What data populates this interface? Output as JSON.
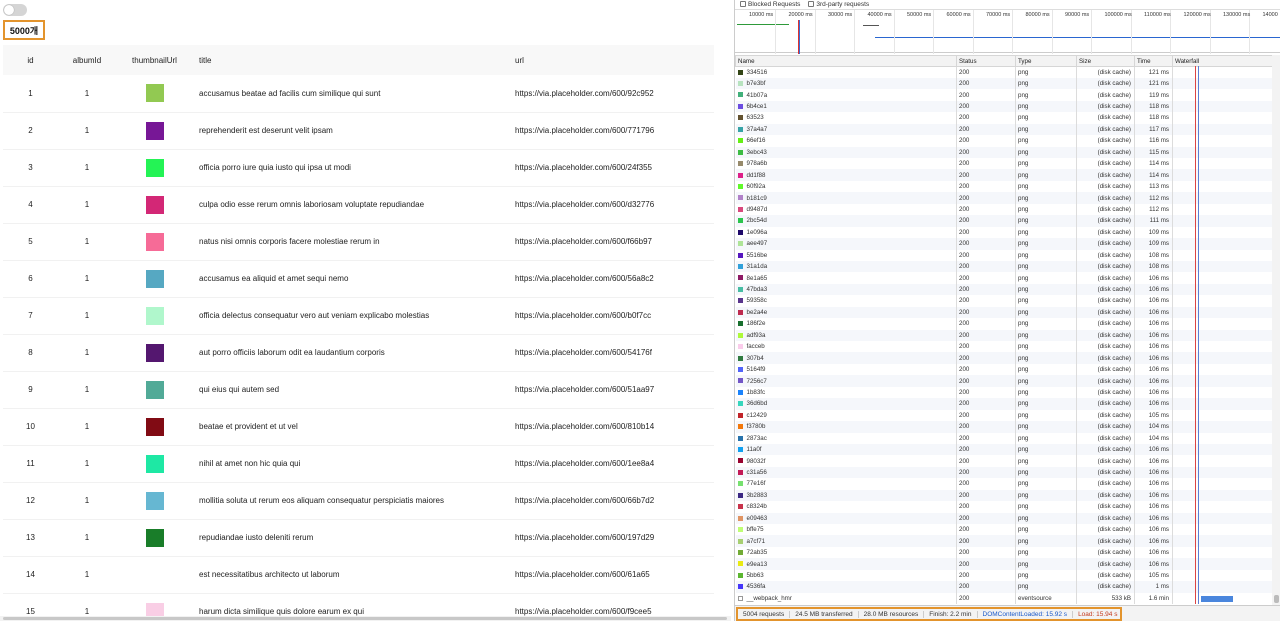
{
  "app": {
    "count_label": "5000개",
    "columns": [
      "id",
      "albumId",
      "thumbnailUrl",
      "title",
      "url"
    ],
    "rows": [
      {
        "id": "1",
        "albumId": "1",
        "color": "#92c952",
        "title": "accusamus beatae ad facilis cum similique qui sunt",
        "url": "https://via.placeholder.com/600/92c952"
      },
      {
        "id": "2",
        "albumId": "1",
        "color": "#771796",
        "title": "reprehenderit est deserunt velit ipsam",
        "url": "https://via.placeholder.com/600/771796"
      },
      {
        "id": "3",
        "albumId": "1",
        "color": "#24f355",
        "title": "officia porro iure quia iusto qui ipsa ut modi",
        "url": "https://via.placeholder.com/600/24f355"
      },
      {
        "id": "4",
        "albumId": "1",
        "color": "#d32776",
        "title": "culpa odio esse rerum omnis laboriosam voluptate repudiandae",
        "url": "https://via.placeholder.com/600/d32776"
      },
      {
        "id": "5",
        "albumId": "1",
        "color": "#f66b97",
        "title": "natus nisi omnis corporis facere molestiae rerum in",
        "url": "https://via.placeholder.com/600/f66b97"
      },
      {
        "id": "6",
        "albumId": "1",
        "color": "#56a8c2",
        "title": "accusamus ea aliquid et amet sequi nemo",
        "url": "https://via.placeholder.com/600/56a8c2"
      },
      {
        "id": "7",
        "albumId": "1",
        "color": "#b0f7cc",
        "title": "officia delectus consequatur vero aut veniam explicabo molestias",
        "url": "https://via.placeholder.com/600/b0f7cc"
      },
      {
        "id": "8",
        "albumId": "1",
        "color": "#54176f",
        "title": "aut porro officiis laborum odit ea laudantium corporis",
        "url": "https://via.placeholder.com/600/54176f"
      },
      {
        "id": "9",
        "albumId": "1",
        "color": "#51aa97",
        "title": "qui eius qui autem sed",
        "url": "https://via.placeholder.com/600/51aa97"
      },
      {
        "id": "10",
        "albumId": "1",
        "color": "#810b14",
        "title": "beatae et provident et ut vel",
        "url": "https://via.placeholder.com/600/810b14"
      },
      {
        "id": "11",
        "albumId": "1",
        "color": "#1ee8a4",
        "title": "nihil at amet non hic quia qui",
        "url": "https://via.placeholder.com/600/1ee8a4"
      },
      {
        "id": "12",
        "albumId": "1",
        "color": "#66b7d2",
        "title": "mollitia soluta ut rerum eos aliquam consequatur perspiciatis maiores",
        "url": "https://via.placeholder.com/600/66b7d2"
      },
      {
        "id": "13",
        "albumId": "1",
        "color": "#197d29",
        "title": "repudiandae iusto deleniti rerum",
        "url": "https://via.placeholder.com/600/197d29"
      },
      {
        "id": "14",
        "albumId": "1",
        "color": "#61a65",
        "title": "est necessitatibus architecto ut laborum",
        "url": "https://via.placeholder.com/600/61a65"
      },
      {
        "id": "15",
        "albumId": "1",
        "color": "#f9cee5",
        "title": "harum dicta similique quis dolore earum ex qui",
        "url": "https://via.placeholder.com/600/f9cee5"
      }
    ]
  },
  "devtools": {
    "filters": {
      "blocked": "Blocked Requests",
      "third_party": "3rd-party requests"
    },
    "ticks": [
      "10000 ms",
      "20000 ms",
      "30000 ms",
      "40000 ms",
      "50000 ms",
      "60000 ms",
      "70000 ms",
      "80000 ms",
      "90000 ms",
      "100000 ms",
      "110000 ms",
      "120000 ms",
      "130000 ms",
      "14000"
    ],
    "columns": [
      "Name",
      "Status",
      "Type",
      "Size",
      "Time",
      "Waterfall"
    ],
    "requests": [
      {
        "name": "334516",
        "status": "200",
        "type": "png",
        "size": "(disk cache)",
        "time": "121 ms"
      },
      {
        "name": "b7e3bf",
        "status": "200",
        "type": "png",
        "size": "(disk cache)",
        "time": "121 ms"
      },
      {
        "name": "41b07a",
        "status": "200",
        "type": "png",
        "size": "(disk cache)",
        "time": "119 ms"
      },
      {
        "name": "6b4ce1",
        "status": "200",
        "type": "png",
        "size": "(disk cache)",
        "time": "118 ms"
      },
      {
        "name": "63523",
        "status": "200",
        "type": "png",
        "size": "(disk cache)",
        "time": "118 ms"
      },
      {
        "name": "37a4a7",
        "status": "200",
        "type": "png",
        "size": "(disk cache)",
        "time": "117 ms"
      },
      {
        "name": "66ef16",
        "status": "200",
        "type": "png",
        "size": "(disk cache)",
        "time": "116 ms"
      },
      {
        "name": "3ebc43",
        "status": "200",
        "type": "png",
        "size": "(disk cache)",
        "time": "115 ms"
      },
      {
        "name": "978a6b",
        "status": "200",
        "type": "png",
        "size": "(disk cache)",
        "time": "114 ms"
      },
      {
        "name": "dd1f88",
        "status": "200",
        "type": "png",
        "size": "(disk cache)",
        "time": "114 ms"
      },
      {
        "name": "60f92a",
        "status": "200",
        "type": "png",
        "size": "(disk cache)",
        "time": "113 ms"
      },
      {
        "name": "b181c9",
        "status": "200",
        "type": "png",
        "size": "(disk cache)",
        "time": "112 ms"
      },
      {
        "name": "d9487d",
        "status": "200",
        "type": "png",
        "size": "(disk cache)",
        "time": "112 ms"
      },
      {
        "name": "2bc54d",
        "status": "200",
        "type": "png",
        "size": "(disk cache)",
        "time": "111 ms"
      },
      {
        "name": "1e096a",
        "status": "200",
        "type": "png",
        "size": "(disk cache)",
        "time": "109 ms"
      },
      {
        "name": "aee497",
        "status": "200",
        "type": "png",
        "size": "(disk cache)",
        "time": "109 ms"
      },
      {
        "name": "5516be",
        "status": "200",
        "type": "png",
        "size": "(disk cache)",
        "time": "108 ms"
      },
      {
        "name": "31a1da",
        "status": "200",
        "type": "png",
        "size": "(disk cache)",
        "time": "108 ms"
      },
      {
        "name": "8e1a65",
        "status": "200",
        "type": "png",
        "size": "(disk cache)",
        "time": "106 ms"
      },
      {
        "name": "47bda3",
        "status": "200",
        "type": "png",
        "size": "(disk cache)",
        "time": "106 ms"
      },
      {
        "name": "59358c",
        "status": "200",
        "type": "png",
        "size": "(disk cache)",
        "time": "106 ms"
      },
      {
        "name": "be2a4e",
        "status": "200",
        "type": "png",
        "size": "(disk cache)",
        "time": "106 ms"
      },
      {
        "name": "186f2e",
        "status": "200",
        "type": "png",
        "size": "(disk cache)",
        "time": "106 ms"
      },
      {
        "name": "adf93a",
        "status": "200",
        "type": "png",
        "size": "(disk cache)",
        "time": "106 ms"
      },
      {
        "name": "facceb",
        "status": "200",
        "type": "png",
        "size": "(disk cache)",
        "time": "106 ms"
      },
      {
        "name": "307b4",
        "status": "200",
        "type": "png",
        "size": "(disk cache)",
        "time": "106 ms"
      },
      {
        "name": "5164f9",
        "status": "200",
        "type": "png",
        "size": "(disk cache)",
        "time": "106 ms"
      },
      {
        "name": "7256c7",
        "status": "200",
        "type": "png",
        "size": "(disk cache)",
        "time": "106 ms"
      },
      {
        "name": "1b83fc",
        "status": "200",
        "type": "png",
        "size": "(disk cache)",
        "time": "106 ms"
      },
      {
        "name": "36d6bd",
        "status": "200",
        "type": "png",
        "size": "(disk cache)",
        "time": "106 ms"
      },
      {
        "name": "c12429",
        "status": "200",
        "type": "png",
        "size": "(disk cache)",
        "time": "105 ms"
      },
      {
        "name": "f3780b",
        "status": "200",
        "type": "png",
        "size": "(disk cache)",
        "time": "104 ms"
      },
      {
        "name": "2873ac",
        "status": "200",
        "type": "png",
        "size": "(disk cache)",
        "time": "104 ms"
      },
      {
        "name": "11a0f",
        "status": "200",
        "type": "png",
        "size": "(disk cache)",
        "time": "106 ms"
      },
      {
        "name": "98032f",
        "status": "200",
        "type": "png",
        "size": "(disk cache)",
        "time": "106 ms"
      },
      {
        "name": "c31a56",
        "status": "200",
        "type": "png",
        "size": "(disk cache)",
        "time": "106 ms"
      },
      {
        "name": "77e16f",
        "status": "200",
        "type": "png",
        "size": "(disk cache)",
        "time": "106 ms"
      },
      {
        "name": "3b2883",
        "status": "200",
        "type": "png",
        "size": "(disk cache)",
        "time": "106 ms"
      },
      {
        "name": "c8324b",
        "status": "200",
        "type": "png",
        "size": "(disk cache)",
        "time": "106 ms"
      },
      {
        "name": "e09463",
        "status": "200",
        "type": "png",
        "size": "(disk cache)",
        "time": "106 ms"
      },
      {
        "name": "bffe75",
        "status": "200",
        "type": "png",
        "size": "(disk cache)",
        "time": "106 ms"
      },
      {
        "name": "a7cf71",
        "status": "200",
        "type": "png",
        "size": "(disk cache)",
        "time": "106 ms"
      },
      {
        "name": "72ab35",
        "status": "200",
        "type": "png",
        "size": "(disk cache)",
        "time": "106 ms"
      },
      {
        "name": "e9ea13",
        "status": "200",
        "type": "png",
        "size": "(disk cache)",
        "time": "106 ms"
      },
      {
        "name": "5bb63",
        "status": "200",
        "type": "png",
        "size": "(disk cache)",
        "time": "105 ms"
      },
      {
        "name": "4536fa",
        "status": "200",
        "type": "png",
        "size": "(disk cache)",
        "time": "1 ms"
      },
      {
        "name": "__webpack_hmr",
        "status": "200",
        "type": "eventsource",
        "size": "533 kB",
        "time": "1.6 min"
      }
    ],
    "summary": {
      "requests": "5004 requests",
      "transferred": "24.5 MB transferred",
      "resources": "28.0 MB resources",
      "finish": "Finish: 2.2 min",
      "dcl": "DOMContentLoaded: 15.92 s",
      "load": "Load: 15.94 s"
    }
  }
}
